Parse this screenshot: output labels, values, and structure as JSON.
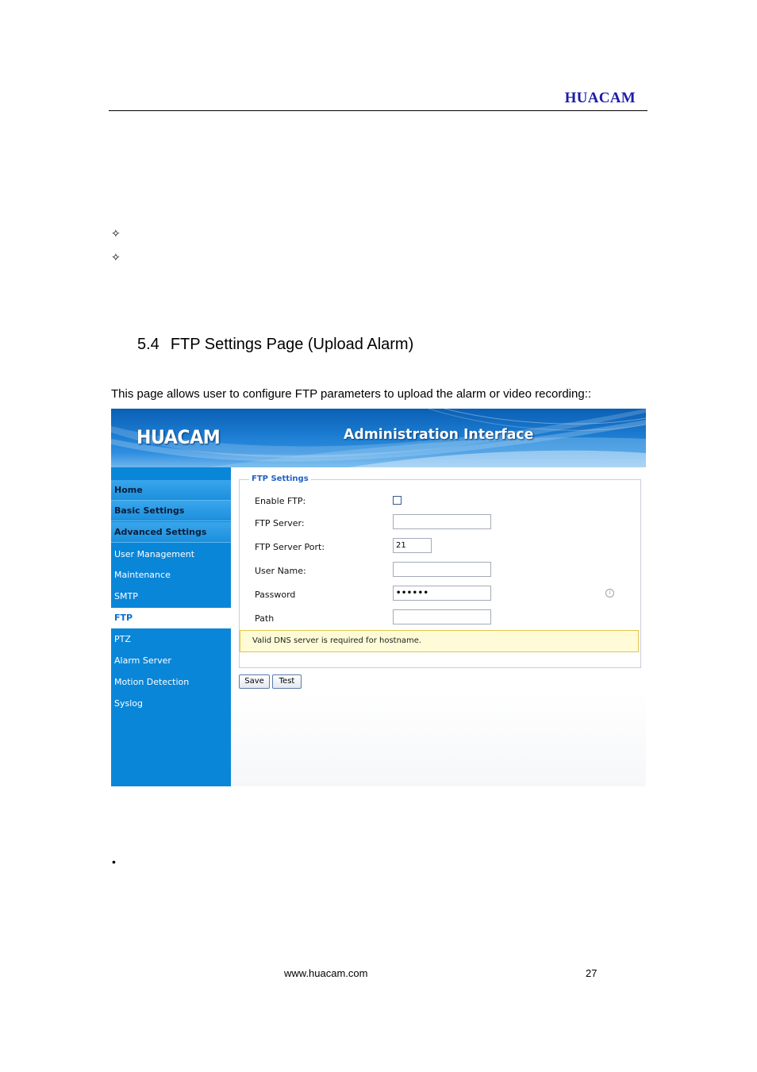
{
  "header": {
    "brand": "HUACAM"
  },
  "bullets": [
    "✧",
    "✧"
  ],
  "section": {
    "number": "5.4",
    "title": "FTP Settings Page (Upload Alarm)"
  },
  "intro": "This page allows user to configure FTP parameters to upload the alarm or video recording::",
  "screenshot": {
    "banner": {
      "logo": "HUACAM",
      "title": "Administration Interface"
    },
    "sidebar": {
      "items": [
        {
          "label": "Home",
          "kind": "category"
        },
        {
          "label": "Basic Settings",
          "kind": "category"
        },
        {
          "label": "Advanced Settings",
          "kind": "category"
        },
        {
          "label": "User Management",
          "kind": "link"
        },
        {
          "label": "Maintenance",
          "kind": "link"
        },
        {
          "label": "SMTP",
          "kind": "link"
        },
        {
          "label": "FTP",
          "kind": "active"
        },
        {
          "label": "PTZ",
          "kind": "link"
        },
        {
          "label": "Alarm Server",
          "kind": "link"
        },
        {
          "label": "Motion Detection",
          "kind": "link"
        },
        {
          "label": "Syslog",
          "kind": "link"
        }
      ]
    },
    "form": {
      "legend": "FTP Settings",
      "enable_ftp_label": "Enable FTP:",
      "enable_ftp_checked": false,
      "server_label": "FTP Server:",
      "server_value": "",
      "port_label": "FTP Server Port:",
      "port_value": "21",
      "username_label": "User Name:",
      "username_value": "",
      "password_label": "Password",
      "password_value": "••••••",
      "info_icon": "i",
      "path_label": "Path",
      "path_value": "",
      "warning": "Valid DNS server is required for hostname."
    },
    "buttons": {
      "save": "Save",
      "test": "Test"
    }
  },
  "bullet2": "•",
  "footer": {
    "url": "www.huacam.com",
    "page": "27"
  }
}
